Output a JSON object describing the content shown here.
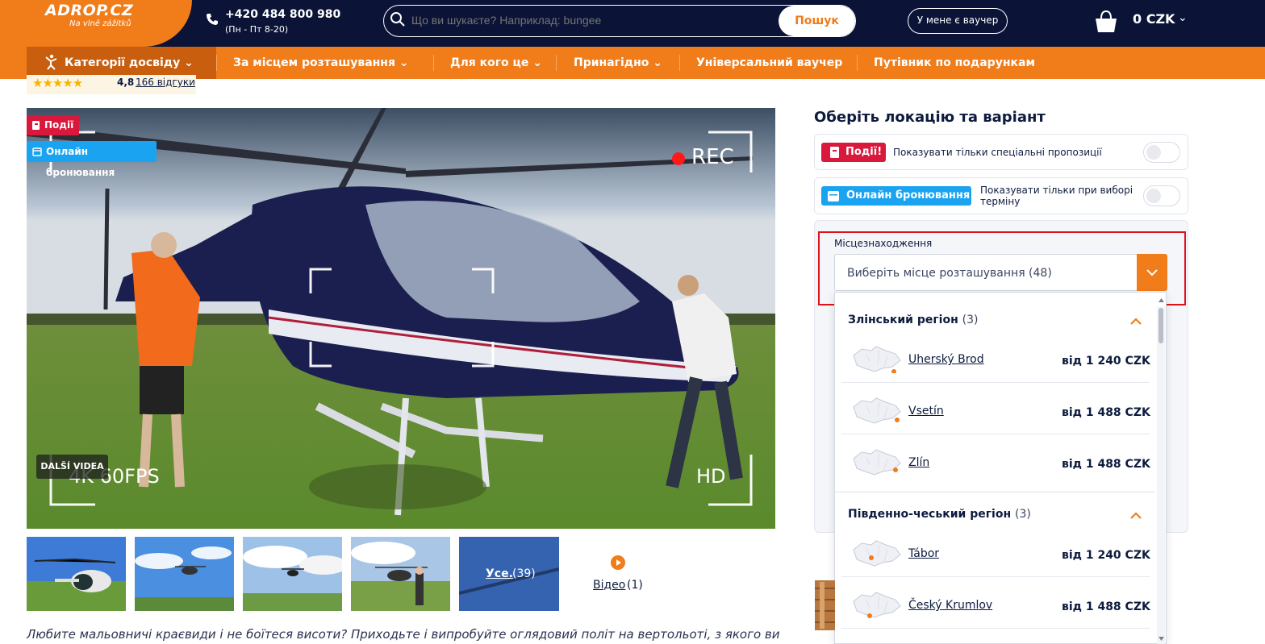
{
  "header": {
    "logo_main": "ADROP.CZ",
    "logo_sub": "Na vlně zážitků",
    "phone": "+420 484 800 980",
    "phone_hours": "(Пн - Пт 8-20)",
    "search_placeholder": "Що ви шукаєте? Наприклад: bungee",
    "search_button": "Пошук",
    "voucher_button": "У мене є ваучер",
    "cart_total": "0 CZK"
  },
  "nav": {
    "items": [
      {
        "label": "Категорії досвіду"
      },
      {
        "label": "За місцем розташування"
      },
      {
        "label": "Для кого це"
      },
      {
        "label": "Принагідно"
      },
      {
        "label": "Універсальний ваучер"
      },
      {
        "label": "Путівник по подарункам"
      }
    ]
  },
  "rating": {
    "stars": "★★★★★",
    "value": "4,8",
    "reviews": "166 відгуки"
  },
  "gallery": {
    "badge_events": "Події",
    "badge_online": "Онлайн бронювання",
    "overlay_rec": "REC",
    "overlay_fps": "4K 60FPS",
    "overlay_hd": "HD",
    "more_videos": "DALŠÍ VIDEA",
    "all_label": "Усе.",
    "all_count": "(39)",
    "video_label": "Відео",
    "video_count": "(1)"
  },
  "description": "Любите мальовничі краєвиди і не боїтеся висоти? Приходьте і випробуйте оглядовий політ на вертольоті, з якого ви",
  "panel": {
    "title": "Оберіть локацію та варіант",
    "events_tag": "Події!",
    "events_text": "Показувати тільки спеціальні пропозиції",
    "online_tag": "Онлайн бронювання",
    "online_text": "Показувати тільки при виборі терміну",
    "location_label": "Місцезнаходження",
    "location_placeholder": "Виберіть місце розташування (48)"
  },
  "regions": [
    {
      "name": "Злінський регіон",
      "count": "(3)",
      "locations": [
        {
          "name": "Uherský Brod",
          "price": "від 1 240 CZK"
        },
        {
          "name": "Vsetín",
          "price": "від 1 488 CZK"
        },
        {
          "name": "Zlín",
          "price": "від 1 488 CZK"
        }
      ]
    },
    {
      "name": "Південно-чеський регіон",
      "count": "(3)",
      "locations": [
        {
          "name": "Tábor",
          "price": "від 1 240 CZK"
        },
        {
          "name": "Český Krumlov",
          "price": "від 1 488 CZK"
        }
      ]
    }
  ],
  "colors": {
    "header_bg": "#0b1437",
    "accent": "#f07c1a",
    "events_red": "#d9183b",
    "online_blue": "#1aa3f0",
    "highlight_red": "#e1101a"
  }
}
